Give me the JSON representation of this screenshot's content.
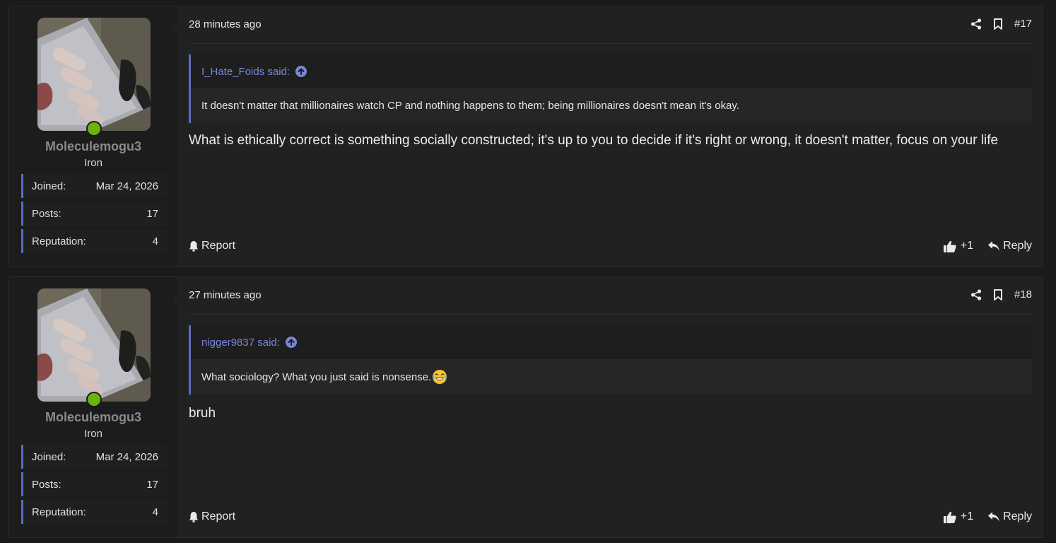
{
  "posts": [
    {
      "username": "Moleculemogu3",
      "user_title": "Iron",
      "stats": [
        {
          "label": "Joined:",
          "value": "Mar 24, 2026"
        },
        {
          "label": "Posts:",
          "value": "17"
        },
        {
          "label": "Reputation:",
          "value": "4"
        }
      ],
      "time": "28 minutes ago",
      "number": "#17",
      "quote": {
        "author": "I_Hate_Foids said:",
        "text": "It doesn't matter that millionaires watch CP and nothing happens to them; being millionaires doesn't mean it's okay."
      },
      "message": "What is ethically correct is something socially constructed; it's up to you to decide if it's right or wrong, it doesn't matter, focus on your life",
      "report_label": "Report",
      "reaction_count": "+1",
      "reply_label": "Reply"
    },
    {
      "username": "Moleculemogu3",
      "user_title": "Iron",
      "stats": [
        {
          "label": "Joined:",
          "value": "Mar 24, 2026"
        },
        {
          "label": "Posts:",
          "value": "17"
        },
        {
          "label": "Reputation:",
          "value": "4"
        }
      ],
      "time": "27 minutes ago",
      "number": "#18",
      "quote": {
        "author": "nigger9837 said:",
        "text": "What sociology? What you just said is nonsense."
      },
      "message": "bruh",
      "report_label": "Report",
      "reaction_count": "+1",
      "reply_label": "Reply"
    }
  ],
  "colors": {
    "accent": "#5c6bc0",
    "quote_author": "#7a86d6",
    "online": "#6bb20a",
    "background": "#1a1a1a",
    "panel": "#212121"
  },
  "icons": {
    "share": "share-icon",
    "bookmark": "bookmark-icon",
    "go_to_quote": "arrow-up-circle-icon",
    "report": "bell-icon",
    "like": "thumbs-up-icon",
    "reply": "reply-icon",
    "emoji": "crying-laughing-emoji"
  }
}
